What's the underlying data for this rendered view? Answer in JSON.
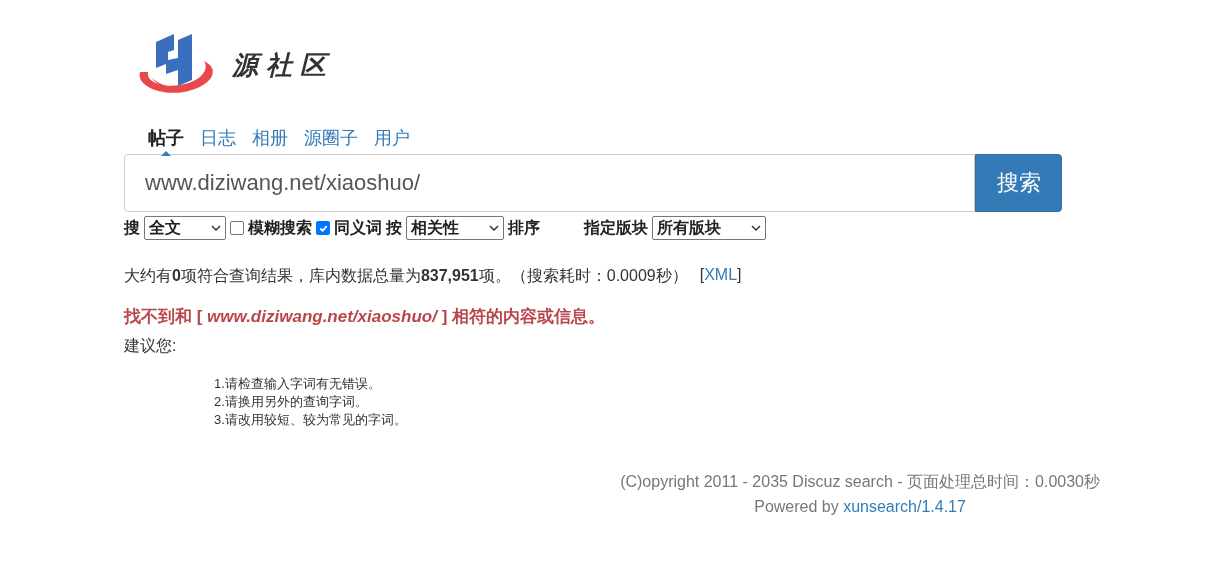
{
  "logo": {
    "text": "源社区"
  },
  "tabs": [
    {
      "label": "帖子",
      "selected": true
    },
    {
      "label": "日志",
      "selected": false
    },
    {
      "label": "相册",
      "selected": false
    },
    {
      "label": "源圈子",
      "selected": false
    },
    {
      "label": "用户",
      "selected": false
    }
  ],
  "search": {
    "value": "www.diziwang.net/xiaoshuo/",
    "button": "搜索"
  },
  "options": [
    {
      "kind": "label",
      "text": "搜"
    },
    {
      "kind": "select",
      "value": "全文"
    },
    {
      "kind": "checkbox",
      "label": "模糊搜索",
      "checked": false
    },
    {
      "kind": "checkbox",
      "label": "同义词",
      "checked": true
    },
    {
      "kind": "label",
      "text": "按"
    },
    {
      "kind": "select",
      "value": "相关性"
    },
    {
      "kind": "label",
      "text": "排序"
    },
    {
      "kind": "gap"
    },
    {
      "kind": "label",
      "text": "指定版块"
    },
    {
      "kind": "select",
      "value": "所有版块"
    }
  ],
  "summary": {
    "text": "大约有**0**项符合查询结果，库内数据总量为**837,951**项。（搜索耗时：0.0009秒）",
    "link_open": "[",
    "link": "XML",
    "link_close": "]"
  },
  "not_found": "找不到和 [ *www.diziwang.net/xiaoshuo/* ] 相符的内容或信息。",
  "suggest_title": "建议您:",
  "suggestions": [
    "1.请检查输入字词有无错误。",
    "2.请换用另外的查询字词。",
    "3.请改用较短、较为常见的字词。"
  ],
  "footer": {
    "copyright": "(C)opyright 2011 - 2035 Discuz search - 页面处理总时间：0.0030秒",
    "powered_by": "Powered by",
    "link": "xunsearch/1.4.17"
  }
}
